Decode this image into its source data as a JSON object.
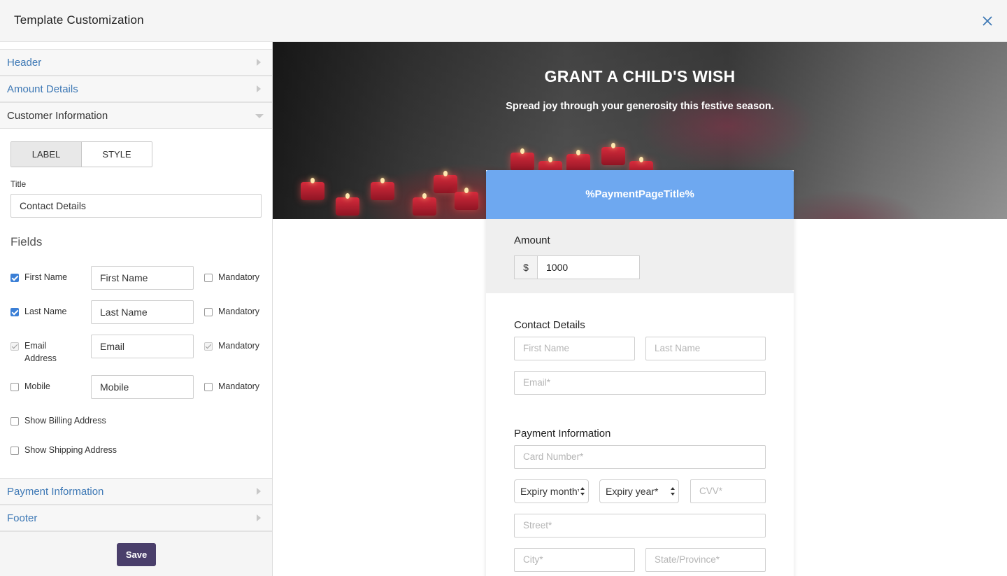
{
  "topbar": {
    "title": "Template Customization",
    "close_icon": "close-icon"
  },
  "sidebar": {
    "sections": [
      {
        "label": "Header",
        "open": false
      },
      {
        "label": "Amount Details",
        "open": false
      },
      {
        "label": "Customer Information",
        "open": true
      },
      {
        "label": "Payment Information",
        "open": false
      },
      {
        "label": "Footer",
        "open": false
      }
    ],
    "tabs": {
      "label": "LABEL",
      "style": "STYLE",
      "active": "LABEL"
    },
    "title_label": "Title",
    "title_value": "Contact Details",
    "fields_heading": "Fields",
    "fields": [
      {
        "name": "First Name",
        "checked": true,
        "value": "First Name",
        "mandatory_label": "Mandatory",
        "mandatory": false
      },
      {
        "name": "Last Name",
        "checked": true,
        "value": "Last Name",
        "mandatory_label": "Mandatory",
        "mandatory": false
      },
      {
        "name": "Email Address",
        "name_line1": "Email",
        "name_line2": "Address",
        "checked": true,
        "disabled": true,
        "value": "Email",
        "mandatory_label": "Mandatory",
        "mandatory": true
      },
      {
        "name": "Mobile",
        "checked": false,
        "value": "Mobile",
        "mandatory_label": "Mandatory",
        "mandatory": false
      }
    ],
    "options": [
      {
        "label": "Show Billing Address",
        "checked": false
      },
      {
        "label": "Show Shipping Address",
        "checked": false
      }
    ],
    "save_label": "Save"
  },
  "preview": {
    "banner_title": "GRANT A CHILD'S WISH",
    "banner_subtitle": "Spread joy through your generosity this festive season.",
    "card_title": "%PaymentPageTitle%",
    "amount_label": "Amount",
    "currency": "$",
    "amount_value": "1000",
    "contact_title": "Contact Details",
    "contact_placeholders": {
      "first": "First Name",
      "last": "Last Name",
      "email": "Email*"
    },
    "payment_title": "Payment Information",
    "payment_placeholders": {
      "card": "Card Number*",
      "expiry_month": "Expiry month*",
      "expiry_year": "Expiry year*",
      "cvv": "CVV*",
      "street": "Street*",
      "city": "City*",
      "state": "State/Province*"
    },
    "accent_color": "#6ea8f0",
    "save_color": "#4a3f6b"
  }
}
